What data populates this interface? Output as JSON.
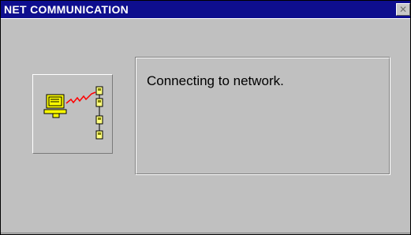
{
  "window": {
    "title": "NET COMMUNICATION",
    "close_glyph": "✕"
  },
  "icon": {
    "name": "network-computer-icon",
    "colors": {
      "monitor": "#ffff00",
      "cable": "#ff0000",
      "node": "#808000"
    }
  },
  "message": {
    "text": "Connecting to network."
  },
  "colors": {
    "titlebar": "#0e0e8e",
    "background": "#c0c0c0"
  }
}
